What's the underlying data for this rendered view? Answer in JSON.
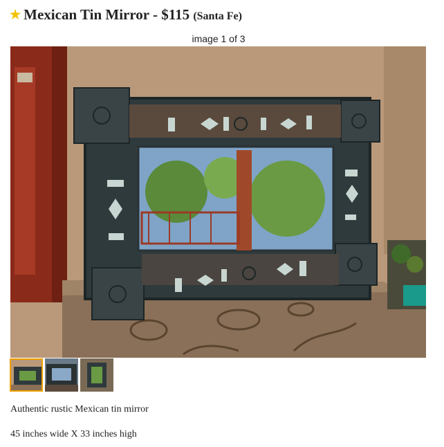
{
  "listing": {
    "title": "Mexican Tin Mirror - $115",
    "location": "(Santa Fe)",
    "favorite_icon": "star-icon",
    "favorite_color": "#f2c200"
  },
  "gallery": {
    "counter": "image 1 of 3",
    "thumbnails": [
      {
        "name": "thumbnail-1",
        "selected": true
      },
      {
        "name": "thumbnail-2",
        "selected": false
      },
      {
        "name": "thumbnail-3",
        "selected": false
      }
    ],
    "selected_border_color": "#f0a000"
  },
  "body": {
    "lines": [
      "Authentic rustic Mexican tin mirror",
      "45 inches wide X 33 inches high"
    ]
  }
}
